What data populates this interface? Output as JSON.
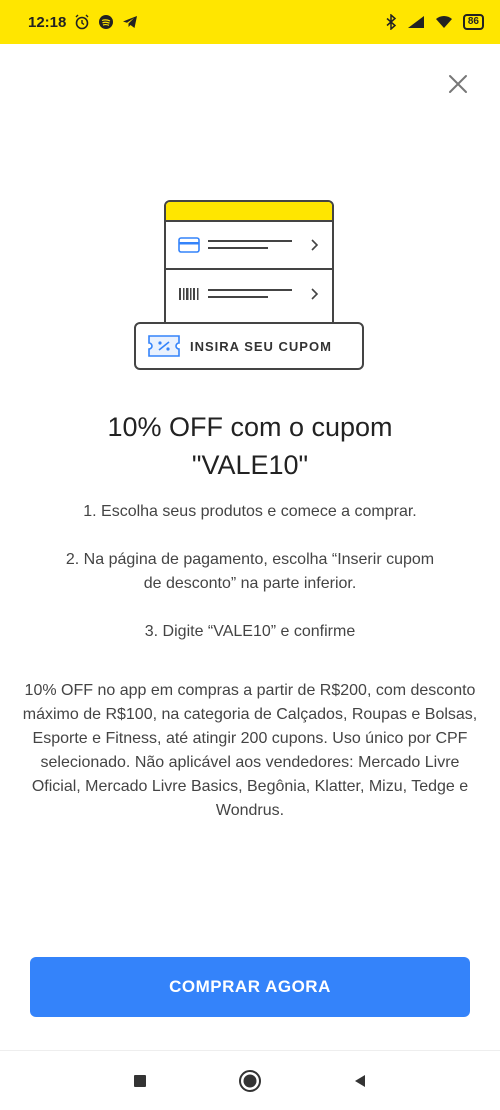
{
  "status_bar": {
    "time": "12:18",
    "battery": "86",
    "icons_left": [
      "alarm-icon",
      "spotify-icon",
      "telegram-icon"
    ],
    "icons_right": [
      "bluetooth-icon",
      "signal-icon",
      "wifi-icon",
      "battery-icon"
    ]
  },
  "illustration": {
    "coupon_label": "INSIRA SEU CUPOM",
    "accent_color": "#FFE600",
    "coupon_icon_color": "#3483FA"
  },
  "headline": {
    "line1": "10% OFF com o cupom",
    "line2": "\"VALE10\""
  },
  "steps": [
    "1. Escolha seus produtos e comece a comprar.",
    "2. Na página de pagamento, escolha “Inserir cupom de desconto” na parte inferior.",
    "3. Digite “VALE10” e confirme"
  ],
  "terms": "10% OFF no app em compras a partir de R$200, com desconto máximo de R$100, na categoria de Calçados, Roupas e Bolsas, Esporte e Fitness, até atingir 200 cupons. Uso único por CPF selecionado. Não aplicável aos vendedores: Mercado Livre Oficial, Mercado Livre Basics, Begônia, Klatter, Mizu, Tedge e Wondrus.",
  "cta": {
    "label": "COMPRAR AGORA",
    "color": "#3483FA"
  },
  "nav": [
    "recents-icon",
    "home-icon",
    "back-icon"
  ]
}
